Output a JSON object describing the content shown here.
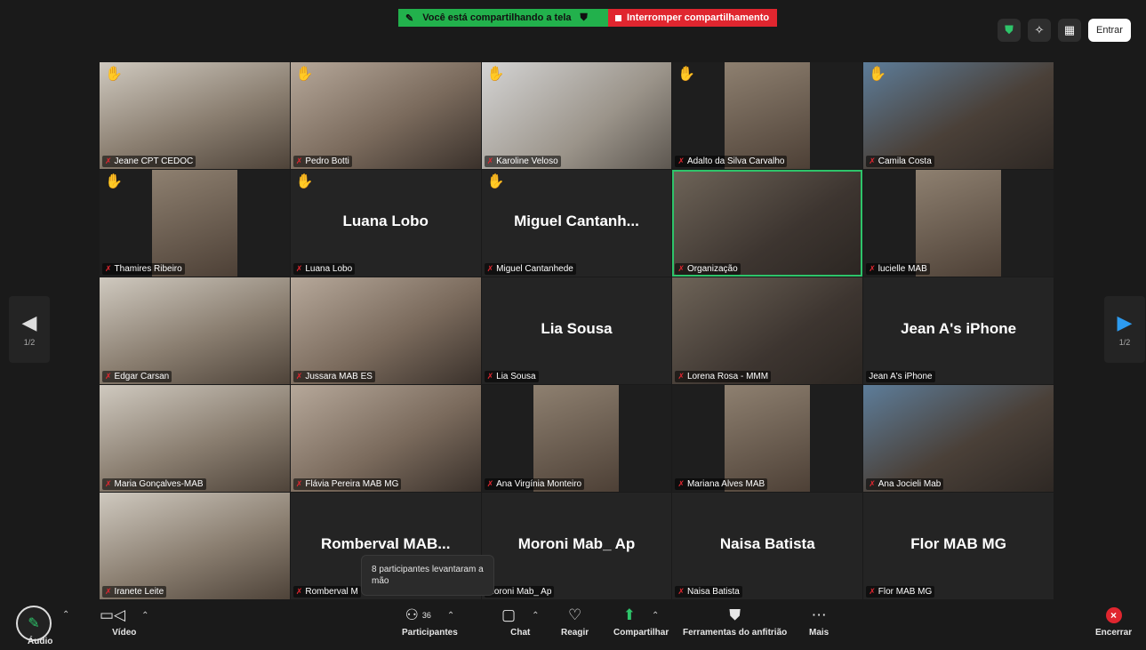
{
  "share_bar": {
    "sharing_text": "Você está compartilhando a tela",
    "stop_text": "Interromper compartilhamento"
  },
  "top_right": {
    "enter_label": "Entrar"
  },
  "navigation": {
    "left_page": "1/2",
    "right_page": "1/2"
  },
  "tiles": [
    {
      "name": "Jeane  CPT  CEDOC",
      "hand": true,
      "display": "video"
    },
    {
      "name": "Pedro Botti",
      "hand": true,
      "display": "video"
    },
    {
      "name": "Karoline Veloso",
      "hand": true,
      "display": "video"
    },
    {
      "name": "Adalto da Silva Carvalho",
      "hand": true,
      "display": "narrow"
    },
    {
      "name": "Camila Costa",
      "hand": true,
      "display": "video"
    },
    {
      "name": "Thamires Ribeiro",
      "hand": true,
      "display": "narrow"
    },
    {
      "name": "Luana Lobo",
      "big_name": "Luana Lobo",
      "hand": true,
      "display": "name"
    },
    {
      "name": "Miguel Cantanhede",
      "big_name": "Miguel  Cantanh...",
      "hand": true,
      "display": "name"
    },
    {
      "name": "Organização",
      "hand": false,
      "display": "video",
      "active": true
    },
    {
      "name": "lucielle MAB",
      "hand": false,
      "display": "narrow"
    },
    {
      "name": "Edgar Carsan",
      "hand": false,
      "display": "video"
    },
    {
      "name": "Jussara MAB ES",
      "hand": false,
      "display": "video"
    },
    {
      "name": "Lia Sousa",
      "big_name": "Lia Sousa",
      "hand": false,
      "display": "name"
    },
    {
      "name": "Lorena Rosa - MMM",
      "hand": false,
      "display": "video"
    },
    {
      "name": "Jean A's iPhone",
      "big_name": "Jean A's iPhone",
      "hand": false,
      "display": "name",
      "no_mic": true
    },
    {
      "name": "Maria Gonçalves-MAB",
      "hand": false,
      "display": "video"
    },
    {
      "name": "Flávia Pereira MAB MG",
      "hand": false,
      "display": "video"
    },
    {
      "name": "Ana Virgínia Monteiro",
      "hand": false,
      "display": "narrow"
    },
    {
      "name": "Mariana Alves MAB",
      "hand": false,
      "display": "narrow"
    },
    {
      "name": "Ana Jocieli Mab",
      "hand": false,
      "display": "video"
    },
    {
      "name": "Iranete Leite",
      "hand": false,
      "display": "video"
    },
    {
      "name": "Romberval M",
      "big_name": "Romberval  MAB...",
      "hand": false,
      "display": "name"
    },
    {
      "name": "Moroni Mab_ Ap",
      "big_name": "Moroni Mab_ Ap",
      "hand": false,
      "display": "name",
      "no_mic": true
    },
    {
      "name": "Naisa Batista",
      "big_name": "Naisa Batista",
      "hand": false,
      "display": "name"
    },
    {
      "name": "Flor MAB MG",
      "big_name": "Flor MAB MG",
      "hand": false,
      "display": "name"
    }
  ],
  "tooltip": {
    "text": "8 participantes levantaram a mão"
  },
  "toolbar": {
    "audio": "Áudio",
    "video": "Vídeo",
    "participants": "Participantes",
    "participants_count": "36",
    "chat": "Chat",
    "react": "Reagir",
    "share": "Compartilhar",
    "host_tools": "Ferramentas do anfitrião",
    "more": "Mais",
    "end": "Encerrar"
  },
  "colors": {
    "share_green": "#22b14c",
    "share_red": "#e0262f",
    "active_border": "#2ec46a",
    "hand": "#f5b321"
  }
}
